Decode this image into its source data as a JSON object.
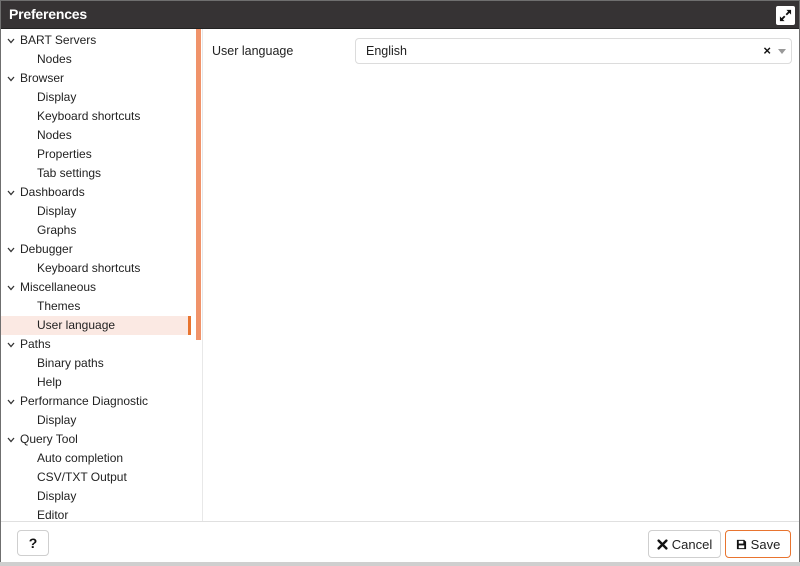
{
  "window": {
    "title": "Preferences",
    "maximize_icon": "expand-icon"
  },
  "tree": {
    "items": [
      {
        "label": "BART Servers",
        "level": 0,
        "expanded": true
      },
      {
        "label": "Nodes",
        "level": 1
      },
      {
        "label": "Browser",
        "level": 0,
        "expanded": true
      },
      {
        "label": "Display",
        "level": 1
      },
      {
        "label": "Keyboard shortcuts",
        "level": 1
      },
      {
        "label": "Nodes",
        "level": 1
      },
      {
        "label": "Properties",
        "level": 1
      },
      {
        "label": "Tab settings",
        "level": 1
      },
      {
        "label": "Dashboards",
        "level": 0,
        "expanded": true
      },
      {
        "label": "Display",
        "level": 1
      },
      {
        "label": "Graphs",
        "level": 1
      },
      {
        "label": "Debugger",
        "level": 0,
        "expanded": true
      },
      {
        "label": "Keyboard shortcuts",
        "level": 1
      },
      {
        "label": "Miscellaneous",
        "level": 0,
        "expanded": true
      },
      {
        "label": "Themes",
        "level": 1
      },
      {
        "label": "User language",
        "level": 1,
        "selected": true
      },
      {
        "label": "Paths",
        "level": 0,
        "expanded": true
      },
      {
        "label": "Binary paths",
        "level": 1
      },
      {
        "label": "Help",
        "level": 1
      },
      {
        "label": "Performance Diagnostic",
        "level": 0,
        "expanded": true
      },
      {
        "label": "Display",
        "level": 1
      },
      {
        "label": "Query Tool",
        "level": 0,
        "expanded": true
      },
      {
        "label": "Auto completion",
        "level": 1
      },
      {
        "label": "CSV/TXT Output",
        "level": 1
      },
      {
        "label": "Display",
        "level": 1
      },
      {
        "label": "Editor",
        "level": 1
      }
    ]
  },
  "content": {
    "field_label": "User language",
    "select": {
      "value": "English",
      "clear_symbol": "×"
    }
  },
  "footer": {
    "help_label": "?",
    "cancel_label": "Cancel",
    "save_label": "Save"
  },
  "colors": {
    "accent": "#e8742f",
    "scrollbar": "#f0936a",
    "selected_bg": "#fbe9e3",
    "titlebar": "#363334"
  }
}
